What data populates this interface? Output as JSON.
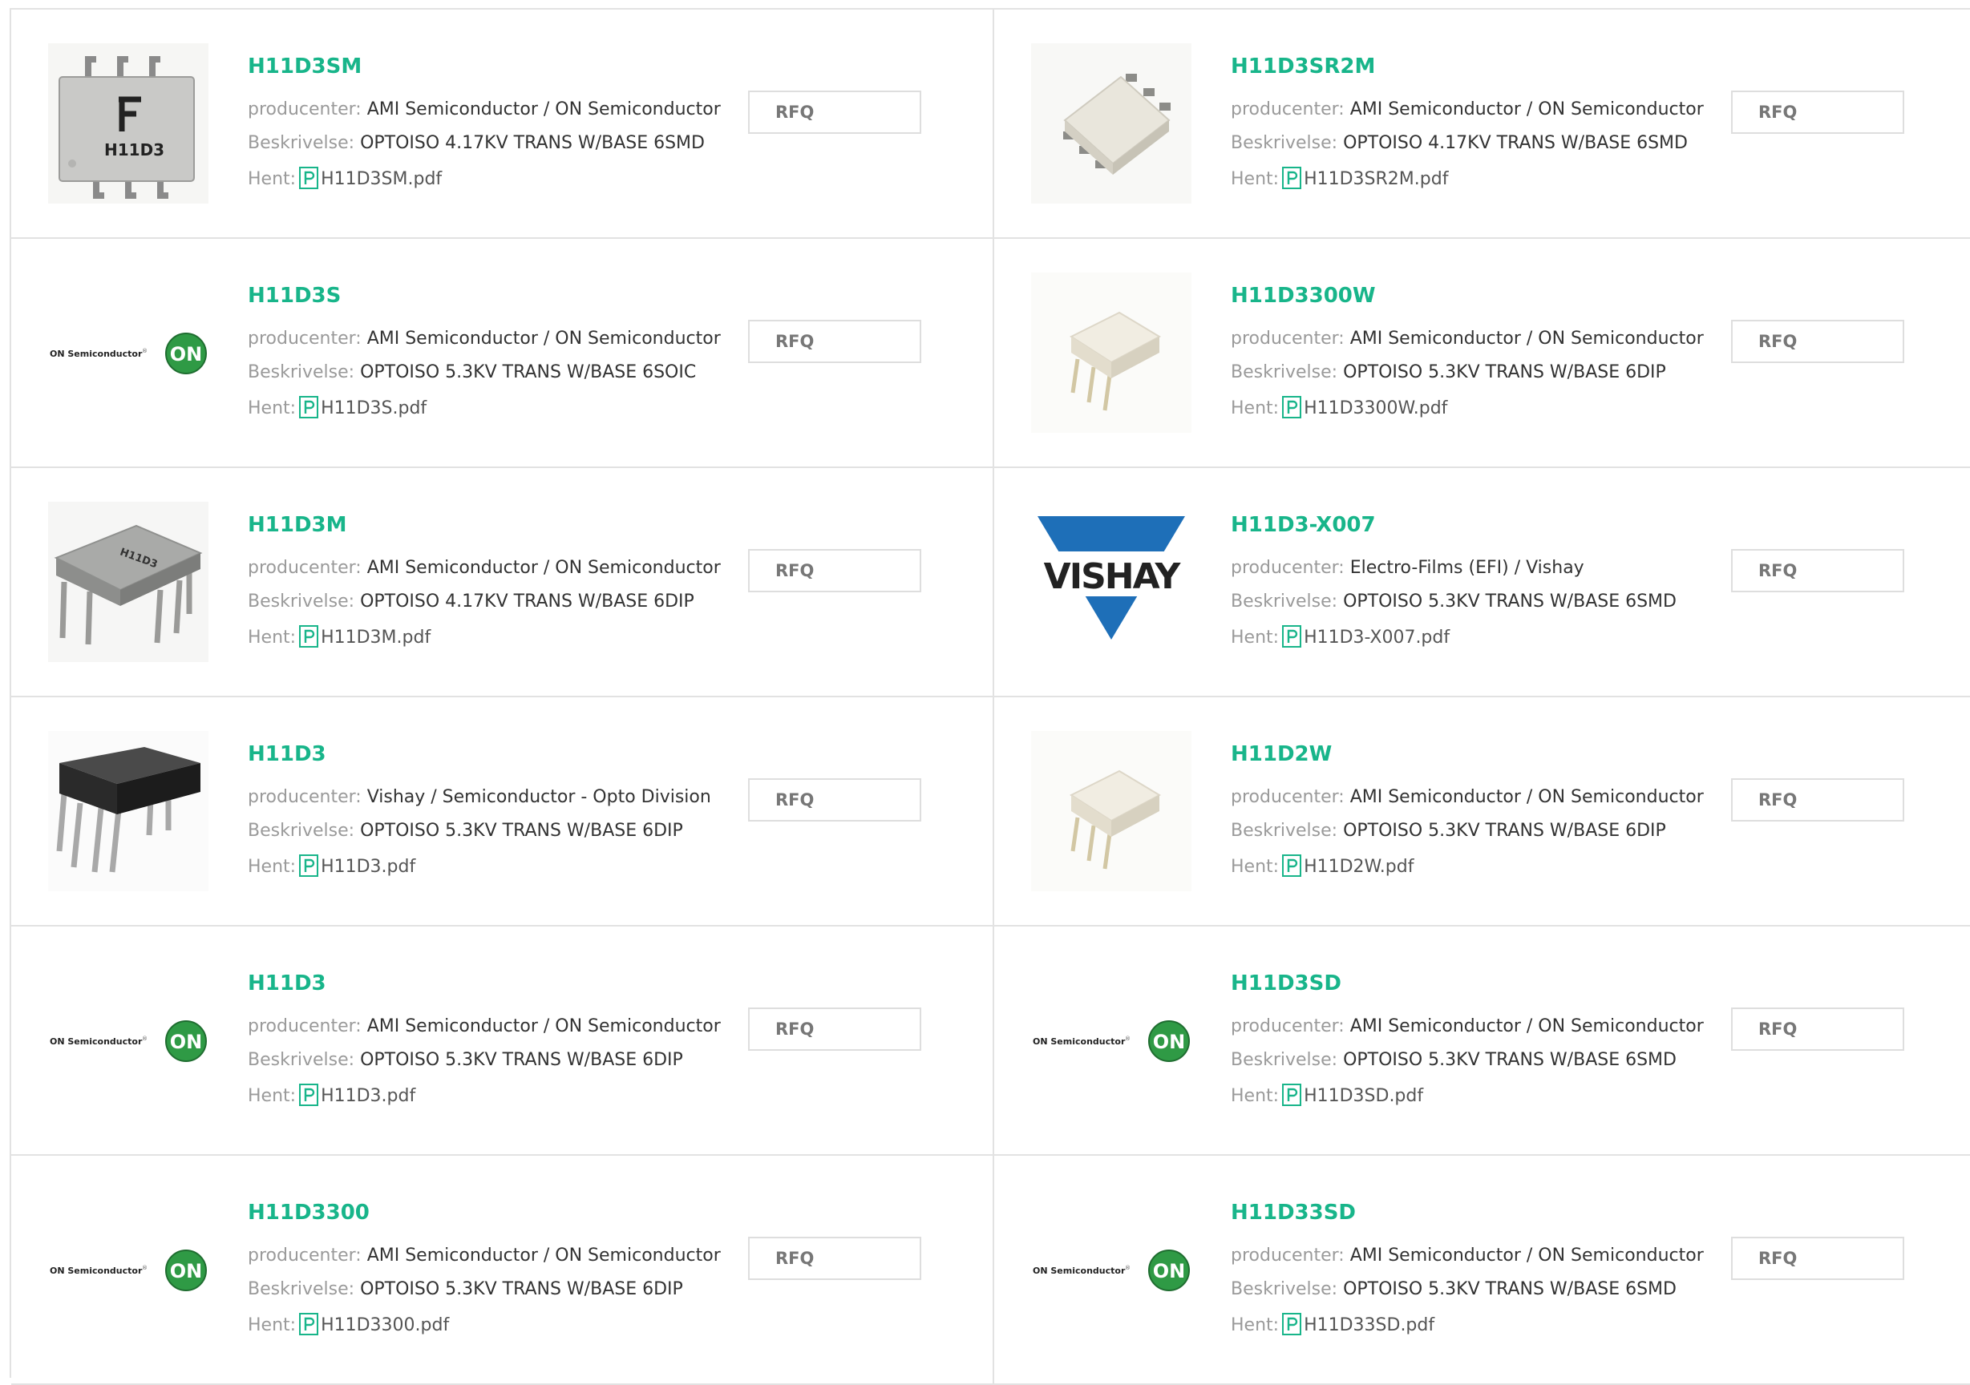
{
  "labels": {
    "manufacturer": "producenter:",
    "description": "Beskrivelse:",
    "download": "Hent:",
    "rfq": "RFQ"
  },
  "products": [
    {
      "part": "H11D3SM",
      "manufacturer": "AMI Semiconductor / ON Semiconductor",
      "description": "OPTOISO 4.17KV TRANS W/BASE 6SMD",
      "pdf": "H11D3SM.pdf",
      "image": "fairchild-smd-chip"
    },
    {
      "part": "H11D3SR2M",
      "manufacturer": "AMI Semiconductor / ON Semiconductor",
      "description": "OPTOISO 4.17KV TRANS W/BASE 6SMD",
      "pdf": "H11D3SR2M.pdf",
      "image": "white-smd-chip"
    },
    {
      "part": "H11D3S",
      "manufacturer": "AMI Semiconductor / ON Semiconductor",
      "description": "OPTOISO 5.3KV TRANS W/BASE 6SOIC",
      "pdf": "H11D3S.pdf",
      "image": "on-semiconductor-logo"
    },
    {
      "part": "H11D3300W",
      "manufacturer": "AMI Semiconductor / ON Semiconductor",
      "description": "OPTOISO 5.3KV TRANS W/BASE 6DIP",
      "pdf": "H11D3300W.pdf",
      "image": "white-dip-chip"
    },
    {
      "part": "H11D3M",
      "manufacturer": "AMI Semiconductor / ON Semiconductor",
      "description": "OPTOISO 4.17KV TRANS W/BASE 6DIP",
      "pdf": "H11D3M.pdf",
      "image": "grey-dip-chip"
    },
    {
      "part": "H11D3-X007",
      "manufacturer": "Electro-Films (EFI) / Vishay",
      "description": "OPTOISO 5.3KV TRANS W/BASE 6SMD",
      "pdf": "H11D3-X007.pdf",
      "image": "vishay-logo"
    },
    {
      "part": "H11D3",
      "manufacturer": "Vishay / Semiconductor - Opto Division",
      "description": "OPTOISO 5.3KV TRANS W/BASE 6DIP",
      "pdf": "H11D3.pdf",
      "image": "black-dip-chip"
    },
    {
      "part": "H11D2W",
      "manufacturer": "AMI Semiconductor / ON Semiconductor",
      "description": "OPTOISO 5.3KV TRANS W/BASE 6DIP",
      "pdf": "H11D2W.pdf",
      "image": "white-dip-chip"
    },
    {
      "part": "H11D3",
      "manufacturer": "AMI Semiconductor / ON Semiconductor",
      "description": "OPTOISO 5.3KV TRANS W/BASE 6DIP",
      "pdf": "H11D3.pdf",
      "image": "on-semiconductor-logo"
    },
    {
      "part": "H11D3SD",
      "manufacturer": "AMI Semiconductor / ON Semiconductor",
      "description": "OPTOISO 5.3KV TRANS W/BASE 6SMD",
      "pdf": "H11D3SD.pdf",
      "image": "on-semiconductor-logo"
    },
    {
      "part": "H11D3300",
      "manufacturer": "AMI Semiconductor / ON Semiconductor",
      "description": "OPTOISO 5.3KV TRANS W/BASE 6DIP",
      "pdf": "H11D3300.pdf",
      "image": "on-semiconductor-logo"
    },
    {
      "part": "H11D33SD",
      "manufacturer": "AMI Semiconductor / ON Semiconductor",
      "description": "OPTOISO 5.3KV TRANS W/BASE 6SMD",
      "pdf": "H11D33SD.pdf",
      "image": "on-semiconductor-logo"
    }
  ],
  "logo_text": {
    "on_brand": "ON Semiconductor",
    "on_badge": "ON",
    "vishay": "VISHAY",
    "chip_marking": "H11D3"
  },
  "colors": {
    "accent": "#18b58a",
    "border": "#e2e2e2",
    "label": "#9a9a9a",
    "text": "#333333",
    "on_green": "#2f9a45",
    "vishay_blue": "#1e6fb8"
  }
}
